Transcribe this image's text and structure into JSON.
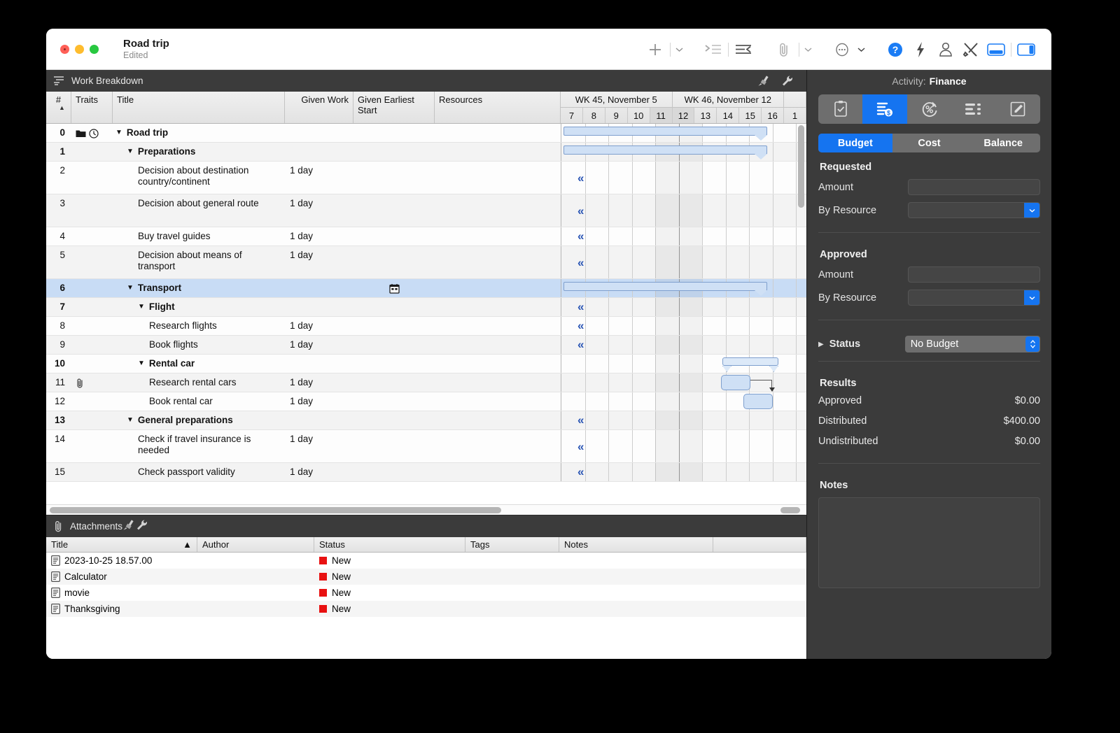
{
  "window": {
    "title": "Road trip",
    "subtitle": "Edited",
    "traffic_lights": [
      "close",
      "minimize",
      "zoom"
    ]
  },
  "toolbar": {
    "items": [
      {
        "name": "add-button",
        "icon": "plus-icon"
      },
      {
        "name": "add-menu-button",
        "icon": "chevron-down-icon"
      },
      {
        "name": "indent-button",
        "icon": "indent-right-icon"
      },
      {
        "name": "outdent-button",
        "icon": "outdent-left-icon"
      },
      {
        "name": "attach-button",
        "icon": "paperclip-icon"
      },
      {
        "name": "attach-menu-button",
        "icon": "chevron-down-icon"
      },
      {
        "name": "more-button",
        "icon": "ellipsis-circle-icon"
      },
      {
        "name": "more-menu-button",
        "icon": "chevron-down-icon"
      },
      {
        "name": "help-button",
        "icon": "question-mark-icon"
      },
      {
        "name": "quick-actions-button",
        "icon": "lightning-bolt-icon"
      },
      {
        "name": "resources-button",
        "icon": "person-icon"
      },
      {
        "name": "tools-button",
        "icon": "hammer-wrench-icon"
      },
      {
        "name": "toggle-bottom-panel-button",
        "icon": "bottom-panel-icon"
      },
      {
        "name": "toggle-right-panel-button",
        "icon": "right-panel-icon"
      }
    ]
  },
  "work_breakdown": {
    "header_title": "Work Breakdown",
    "header_icons": [
      "paintbrush-icon",
      "wrench-icon"
    ],
    "columns": [
      {
        "key": "num",
        "label": "#",
        "sorted": true,
        "sort_dir": "asc"
      },
      {
        "key": "traits",
        "label": "Traits"
      },
      {
        "key": "title",
        "label": "Title"
      },
      {
        "key": "work",
        "label": "Given Work"
      },
      {
        "key": "start",
        "label": "Given Earliest Start"
      },
      {
        "key": "resources",
        "label": "Resources"
      }
    ],
    "rows": [
      {
        "num": "0",
        "title": "Road trip",
        "work": "",
        "indent": 0,
        "bold": true,
        "disclosure": true,
        "traits": [
          "folder-icon",
          "clock-icon"
        ]
      },
      {
        "num": "1",
        "title": "Preparations",
        "work": "",
        "indent": 1,
        "bold": true,
        "disclosure": true,
        "traits": []
      },
      {
        "num": "2",
        "title": "Decision about destination country/continent",
        "work": "1 day",
        "indent": 2,
        "bold": false,
        "disclosure": false,
        "traits": []
      },
      {
        "num": "3",
        "title": "Decision about general route",
        "work": "1 day",
        "indent": 2,
        "bold": false,
        "disclosure": false,
        "traits": []
      },
      {
        "num": "4",
        "title": "Buy travel guides",
        "work": "1 day",
        "indent": 2,
        "bold": false,
        "disclosure": false,
        "traits": []
      },
      {
        "num": "5",
        "title": "Decision about means of transport",
        "work": "1 day",
        "indent": 2,
        "bold": false,
        "disclosure": false,
        "traits": []
      },
      {
        "num": "6",
        "title": "Transport",
        "work": "",
        "indent": 1,
        "bold": true,
        "disclosure": true,
        "traits": [],
        "selected": true,
        "start_icon": "calendar-icon"
      },
      {
        "num": "7",
        "title": "Flight",
        "work": "",
        "indent": 2,
        "bold": true,
        "disclosure": true,
        "traits": []
      },
      {
        "num": "8",
        "title": "Research flights",
        "work": "1 day",
        "indent": 3,
        "bold": false,
        "disclosure": false,
        "traits": []
      },
      {
        "num": "9",
        "title": "Book flights",
        "work": "1 day",
        "indent": 3,
        "bold": false,
        "disclosure": false,
        "traits": []
      },
      {
        "num": "10",
        "title": "Rental car",
        "work": "",
        "indent": 2,
        "bold": true,
        "disclosure": true,
        "traits": []
      },
      {
        "num": "11",
        "title": "Research rental cars",
        "work": "1 day",
        "indent": 3,
        "bold": false,
        "disclosure": false,
        "traits": [
          "paperclip-icon"
        ]
      },
      {
        "num": "12",
        "title": "Book rental car",
        "work": "1 day",
        "indent": 3,
        "bold": false,
        "disclosure": false,
        "traits": []
      },
      {
        "num": "13",
        "title": "General preparations",
        "work": "",
        "indent": 1,
        "bold": true,
        "disclosure": true,
        "traits": []
      },
      {
        "num": "14",
        "title": "Check if travel insurance is needed",
        "work": "1 day",
        "indent": 2,
        "bold": false,
        "disclosure": false,
        "traits": []
      },
      {
        "num": "15",
        "title": "Check passport validity",
        "work": "1 day",
        "indent": 2,
        "bold": false,
        "disclosure": false,
        "traits": []
      }
    ]
  },
  "gantt": {
    "weeks": [
      {
        "label": "WK 45, November 5",
        "days": [
          "7",
          "8",
          "9",
          "10",
          "11"
        ]
      },
      {
        "label": "WK 46, November 12",
        "days": [
          "12",
          "13",
          "14",
          "15",
          "16"
        ]
      },
      {
        "label": "",
        "days": [
          "1"
        ]
      }
    ],
    "bar_color": "#cfe0f5",
    "bar_border": "#7e9fce",
    "milestone_glyph": "«"
  },
  "attachments": {
    "header_title": "Attachments",
    "header_icons": [
      "paintbrush-icon",
      "wrench-icon"
    ],
    "columns": [
      {
        "key": "title",
        "label": "Title",
        "sorted": true,
        "sort_dir": "asc"
      },
      {
        "key": "author",
        "label": "Author"
      },
      {
        "key": "status",
        "label": "Status"
      },
      {
        "key": "tags",
        "label": "Tags"
      },
      {
        "key": "notes",
        "label": "Notes"
      }
    ],
    "rows": [
      {
        "title": "2023-10-25 18.57.00",
        "author": "",
        "status": "New",
        "tags": "",
        "notes": "",
        "icon": "document-icon",
        "status_color": "#e81111"
      },
      {
        "title": "Calculator",
        "author": "",
        "status": "New",
        "tags": "",
        "notes": "",
        "icon": "document-icon",
        "status_color": "#e81111"
      },
      {
        "title": "movie",
        "author": "",
        "status": "New",
        "tags": "",
        "notes": "",
        "icon": "document-icon",
        "status_color": "#e81111"
      },
      {
        "title": "Thanksgiving",
        "author": "",
        "status": "New",
        "tags": "",
        "notes": "",
        "icon": "document-icon",
        "status_color": "#e81111"
      }
    ]
  },
  "inspector": {
    "title_label": "Activity:",
    "title_value": "Finance",
    "icon_tabs": [
      {
        "name": "info-tab",
        "icon": "clipboard-check-icon",
        "active": false
      },
      {
        "name": "finance-tab",
        "icon": "budget-money-icon",
        "active": true
      },
      {
        "name": "progress-tab",
        "icon": "percent-circle-icon",
        "active": false
      },
      {
        "name": "resources-tab",
        "icon": "list-bullets-icon",
        "active": false
      },
      {
        "name": "notes-tab",
        "icon": "pencil-icon",
        "active": false
      }
    ],
    "segments": [
      {
        "label": "Budget",
        "active": true
      },
      {
        "label": "Cost",
        "active": false
      },
      {
        "label": "Balance",
        "active": false
      }
    ],
    "requested": {
      "heading": "Requested",
      "amount_label": "Amount",
      "amount_value": "",
      "by_resource_label": "By Resource",
      "by_resource_value": ""
    },
    "approved": {
      "heading": "Approved",
      "amount_label": "Amount",
      "amount_value": "",
      "by_resource_label": "By Resource",
      "by_resource_value": ""
    },
    "status": {
      "label": "Status",
      "value": "No Budget"
    },
    "results": {
      "heading": "Results",
      "rows": [
        {
          "label": "Approved",
          "value": "$0.00"
        },
        {
          "label": "Distributed",
          "value": "$400.00"
        },
        {
          "label": "Undistributed",
          "value": "$0.00"
        }
      ]
    },
    "notes": {
      "heading": "Notes",
      "value": ""
    },
    "accent_color": "#1574f0"
  }
}
